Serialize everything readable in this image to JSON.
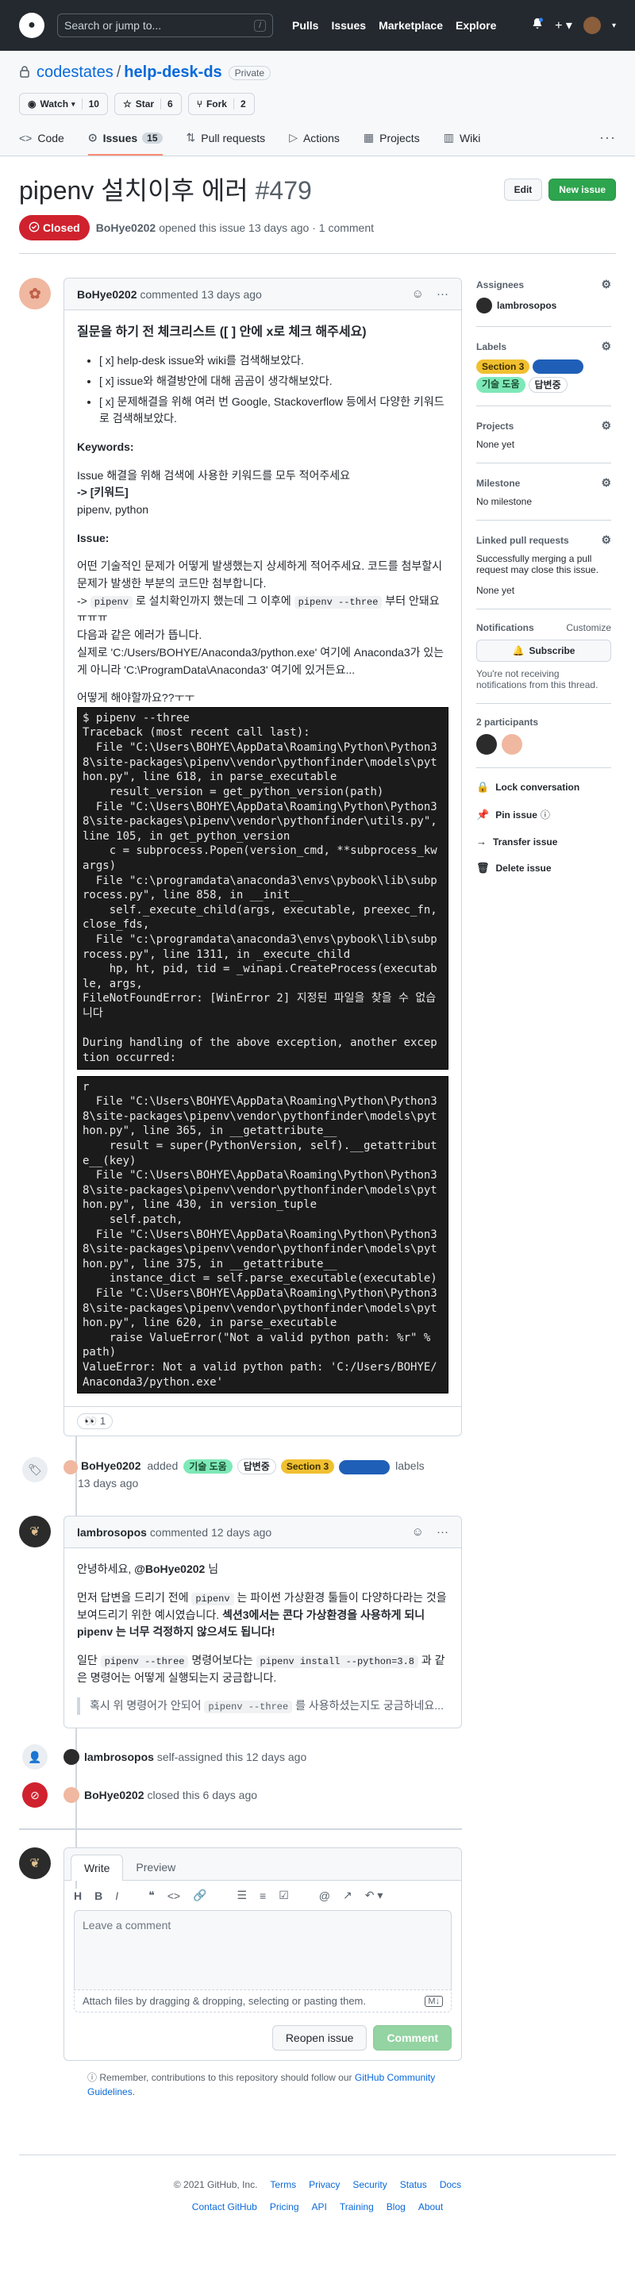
{
  "header": {
    "search_placeholder": "Search or jump to...",
    "search_key": "/",
    "nav": [
      "Pulls",
      "Issues",
      "Marketplace",
      "Explore"
    ]
  },
  "repo": {
    "owner": "codestates",
    "separator": "/",
    "name": "help-desk-ds",
    "visibility": "Private",
    "watch": {
      "label": "Watch",
      "count": "10"
    },
    "star": {
      "label": "Star",
      "count": "6"
    },
    "fork": {
      "label": "Fork",
      "count": "2"
    },
    "tabs": [
      {
        "label": "Code"
      },
      {
        "label": "Issues",
        "count": "15"
      },
      {
        "label": "Pull requests"
      },
      {
        "label": "Actions"
      },
      {
        "label": "Projects"
      },
      {
        "label": "Wiki"
      }
    ]
  },
  "issue": {
    "title": "pipenv 설치이후 에러",
    "number": "#479",
    "state": "Closed",
    "edit_label": "Edit",
    "new_issue_label": "New issue",
    "meta_author": "BoHye0202",
    "meta_text": "opened this issue 13 days ago · 1 comment"
  },
  "first_comment": {
    "author": "BoHye0202",
    "time": "commented 13 days ago",
    "heading": "질문을 하기 전 체크리스트 ([ ] 안에 x로 체크 해주세요)",
    "checklist": [
      "[ x] help-desk issue와 wiki를 검색해보았다.",
      "[ x] issue와 해결방안에 대해 곰곰이 생각해보았다.",
      "[ x] 문제해결을 위해 여러 번 Google, Stackoverflow 등에서 다양한 키워드로 검색해보았다."
    ],
    "keywords_title": "Keywords:",
    "keywords_line1": "Issue 해결을 위해 검색에 사용한 키워드를 모두 적어주세요",
    "keywords_line2": "-> [키워드]",
    "keywords_line3": "pipenv, python",
    "issue_title": "Issue:",
    "issue_p1": "어떤 기술적인 문제가 어떻게 발생했는지 상세하게 적어주세요. 코드를 첨부할시 문제가 발생한 부분의 코드만 첨부합니다.",
    "issue_p2_pre": "-> ",
    "issue_p2_code1": "pipenv",
    "issue_p2_mid": " 로 설치확인까지 했는데 그 이후에 ",
    "issue_p2_code2": "pipenv --three",
    "issue_p2_post": " 부터 안돼요ㅠㅠㅠ",
    "issue_p3": "다음과 같은 에러가 뜹니다.",
    "issue_p4": "실제로 'C:/Users/BOHYE/Anaconda3/python.exe' 여기에 Anaconda3가 있는게 아니라 'C:\\ProgramData\\Anaconda3' 여기에 있거든요...",
    "issue_p5": "어떻게 해야할까요??ㅜㅜ",
    "terminal1": "$ pipenv --three\nTraceback (most recent call last):\n  File \"C:\\Users\\BOHYE\\AppData\\Roaming\\Python\\Python38\\site-packages\\pipenv\\vendor\\pythonfinder\\models\\python.py\", line 618, in parse_executable\n    result_version = get_python_version(path)\n  File \"C:\\Users\\BOHYE\\AppData\\Roaming\\Python\\Python38\\site-packages\\pipenv\\vendor\\pythonfinder\\utils.py\", line 105, in get_python_version\n    c = subprocess.Popen(version_cmd, **subprocess_kwargs)\n  File \"c:\\programdata\\anaconda3\\envs\\pybook\\lib\\subprocess.py\", line 858, in __init__\n    self._execute_child(args, executable, preexec_fn, close_fds,\n  File \"c:\\programdata\\anaconda3\\envs\\pybook\\lib\\subprocess.py\", line 1311, in _execute_child\n    hp, ht, pid, tid = _winapi.CreateProcess(executable, args,\nFileNotFoundError: [WinError 2] 지정된 파일을 찾을 수 없습니다\n\nDuring handling of the above exception, another exception occurred:",
    "terminal2": "r\n  File \"C:\\Users\\BOHYE\\AppData\\Roaming\\Python\\Python38\\site-packages\\pipenv\\vendor\\pythonfinder\\models\\python.py\", line 365, in __getattribute__\n    result = super(PythonVersion, self).__getattribute__(key)\n  File \"C:\\Users\\BOHYE\\AppData\\Roaming\\Python\\Python38\\site-packages\\pipenv\\vendor\\pythonfinder\\models\\python.py\", line 430, in version_tuple\n    self.patch,\n  File \"C:\\Users\\BOHYE\\AppData\\Roaming\\Python\\Python38\\site-packages\\pipenv\\vendor\\pythonfinder\\models\\python.py\", line 375, in __getattribute__\n    instance_dict = self.parse_executable(executable)\n  File \"C:\\Users\\BOHYE\\AppData\\Roaming\\Python\\Python38\\site-packages\\pipenv\\vendor\\pythonfinder\\models\\python.py\", line 620, in parse_executable\n    raise ValueError(\"Not a valid python path: %r\" % path)\nValueError: Not a valid python path: 'C:/Users/BOHYE/Anaconda3/python.exe'",
    "reaction_emoji": "👀",
    "reaction_count": "1"
  },
  "label_event": {
    "author": "BoHye0202",
    "action": "added",
    "labels": [
      {
        "name": "기술 도움",
        "bg": "#7ee8b8",
        "fg": "#1a4d30"
      },
      {
        "name": "답변중",
        "bg": "#ffffff",
        "fg": "#24292f"
      },
      {
        "name": "Section 3",
        "bg": "#f0c030",
        "fg": "#3d2e00"
      },
      {
        "name": "",
        "bg": "#1f5fb8",
        "fg": "#ffffff"
      }
    ],
    "suffix": "labels",
    "time": "13 days ago"
  },
  "second_comment": {
    "author": "lambrosopos",
    "time": "commented 12 days ago",
    "greeting_pre": "안녕하세요, ",
    "greeting_mention": "@BoHye0202",
    "greeting_post": " 님",
    "p1_a": "먼저 답변을 드리기 전에 ",
    "p1_code1": "pipenv",
    "p1_b": " 는 파이썬 가상환경 툴들이 다양하다라는 것을 보여드리기 위한 예시였습니다. ",
    "p1_bold": "섹션3에서는 콘다 가상환경을 사용하게 되니 pipenv 는 너무 걱정하지 않으셔도 됩니다!",
    "p2_a": "일단 ",
    "p2_code1": "pipenv --three",
    "p2_b": " 명령어보다는 ",
    "p2_code2": "pipenv install --python=3.8",
    "p2_c": " 과 같은 명령어는 어떻게 실행되는지 궁금합니다.",
    "quote_a": "혹시 위 명령어가 안되어 ",
    "quote_code": "pipenv --three",
    "quote_b": " 를 사용하셨는지도 궁금하네요..."
  },
  "assign_event": {
    "author": "lambrosopos",
    "text": "self-assigned this 12 days ago"
  },
  "close_event": {
    "author": "BoHye0202",
    "text": "closed this 6 days ago"
  },
  "new_comment": {
    "tab_write": "Write",
    "tab_preview": "Preview",
    "placeholder": "Leave a comment",
    "attach_text": "Attach files by dragging & dropping, selecting or pasting them.",
    "md_badge": "M↓",
    "reopen_label": "Reopen issue",
    "comment_label": "Comment",
    "remember_text": "Remember, contributions to this repository should follow our ",
    "remember_link": "GitHub Community Guidelines",
    "remember_end": "."
  },
  "sidebar": {
    "assignees_title": "Assignees",
    "assignee": "lambrosopos",
    "labels_title": "Labels",
    "labels": [
      {
        "name": "Section 3",
        "bg": "#f0c030",
        "fg": "#3d2e00"
      },
      {
        "name": "",
        "bg": "#1f5fb8",
        "fg": "#ffffff"
      },
      {
        "name": "기술 도움",
        "bg": "#7ee8b8",
        "fg": "#1a4d30"
      },
      {
        "name": "답변중",
        "bg": "#ffffff",
        "fg": "#24292f"
      }
    ],
    "projects_title": "Projects",
    "projects_value": "None yet",
    "milestone_title": "Milestone",
    "milestone_value": "No milestone",
    "linked_title": "Linked pull requests",
    "linked_desc": "Successfully merging a pull request may close this issue.",
    "linked_value": "None yet",
    "notif_title": "Notifications",
    "notif_custom": "Customize",
    "subscribe_label": "Subscribe",
    "notif_desc": "You're not receiving notifications from this thread.",
    "participants_title": "2 participants",
    "actions": [
      {
        "icon": "lock",
        "label": "Lock conversation"
      },
      {
        "icon": "pin",
        "label": "Pin issue"
      },
      {
        "icon": "arrow",
        "label": "Transfer issue"
      },
      {
        "icon": "trash",
        "label": "Delete issue"
      }
    ]
  },
  "footer": {
    "copyright": "© 2021 GitHub, Inc.",
    "row1": [
      "Terms",
      "Privacy",
      "Security",
      "Status",
      "Docs"
    ],
    "row2": [
      "Contact GitHub",
      "Pricing",
      "API",
      "Training",
      "Blog",
      "About"
    ]
  },
  "colors": {
    "closed": "#cf222e",
    "green": "#2da44e",
    "link": "#0969da",
    "header_bg": "#24292f"
  }
}
